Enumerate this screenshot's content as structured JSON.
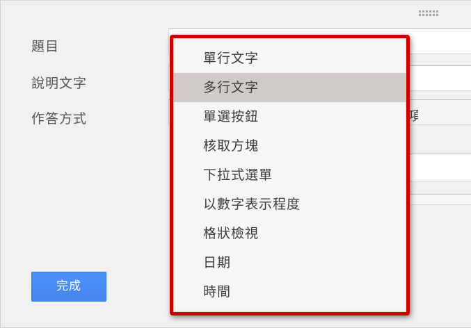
{
  "form": {
    "labels": {
      "title": "題目",
      "description": "說明文字",
      "answer_type": "作答方式"
    },
    "done_button": "完成",
    "partial_hidden_char": "項"
  },
  "dropdown": {
    "selected_index": 1,
    "options": [
      "單行文字",
      "多行文字",
      "單選按鈕",
      "核取方塊",
      "下拉式選單",
      "以數字表示程度",
      "格狀檢視",
      "日期",
      "時間"
    ]
  },
  "colors": {
    "highlight_border": "#cc0000",
    "primary_button": "#4d90fe",
    "selected_option_bg": "#d0cbc9"
  }
}
